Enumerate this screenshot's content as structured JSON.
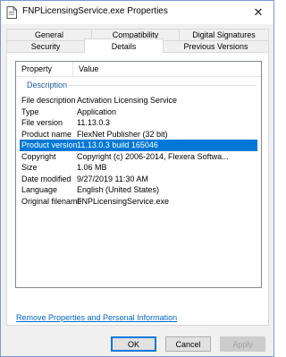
{
  "window": {
    "title": "FNPLicensingService.exe Properties",
    "close_symbol": "✕"
  },
  "tabs": {
    "top": [
      {
        "label": "General"
      },
      {
        "label": "Compatibility"
      },
      {
        "label": "Digital Signatures"
      }
    ],
    "bottom": [
      {
        "label": "Security"
      },
      {
        "label": "Details",
        "active": true
      },
      {
        "label": "Previous Versions"
      }
    ]
  },
  "details": {
    "columns": {
      "property": "Property",
      "value": "Value"
    },
    "group": "Description",
    "rows": [
      {
        "key": "File description",
        "value": "Activation Licensing Service"
      },
      {
        "key": "Type",
        "value": "Application"
      },
      {
        "key": "File version",
        "value": "11.13.0.3"
      },
      {
        "key": "Product name",
        "value": "FlexNet Publisher (32 bit)"
      },
      {
        "key": "Product version",
        "value": "11.13.0.3 build 165046",
        "selected": true
      },
      {
        "key": "Copyright",
        "value": "Copyright (c) 2006-2014, Flexera Softwa..."
      },
      {
        "key": "Size",
        "value": "1.06 MB"
      },
      {
        "key": "Date modified",
        "value": "9/27/2019 11:30 AM"
      },
      {
        "key": "Language",
        "value": "English (United States)"
      },
      {
        "key": "Original filename",
        "value": "FNPLicensingService.exe"
      }
    ],
    "remove_link": "Remove Properties and Personal Information"
  },
  "buttons": {
    "ok": "OK",
    "cancel": "Cancel",
    "apply": "Apply"
  },
  "colors": {
    "selection": "#0078d7",
    "link": "#0066cc",
    "group_label": "#1e5aa8"
  }
}
